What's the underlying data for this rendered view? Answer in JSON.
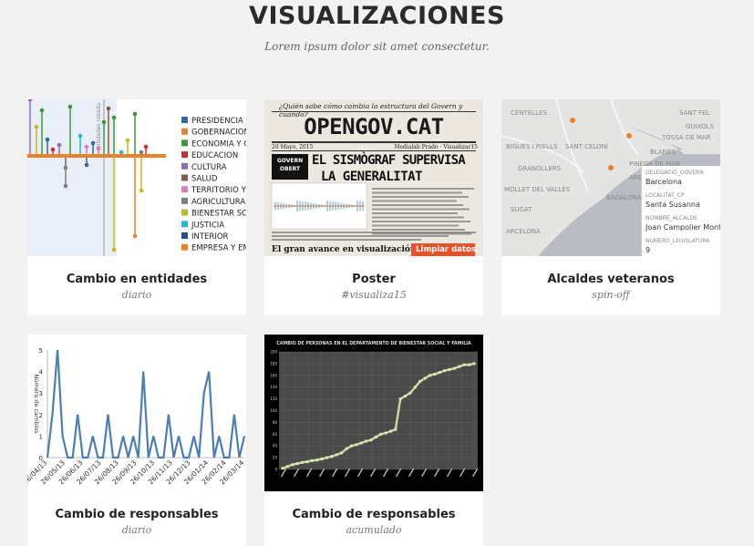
{
  "header": {
    "title": "VISUALIZACIONES",
    "subtitle": "Lorem ipsum dolor sit amet consectetur."
  },
  "cards": [
    {
      "title": "Cambio en entidades",
      "subtitle": "diario",
      "thumb": {
        "axis_label": "entidades creada",
        "legend": [
          {
            "label": "PRESIDENCIA",
            "color": "#2e6da4"
          },
          {
            "label": "GOBERNACION",
            "color": "#e8832a"
          },
          {
            "label": "ECONOMIA Y C",
            "color": "#3a9a3a"
          },
          {
            "label": "EDUCACION",
            "color": "#c9302c"
          },
          {
            "label": "CULTURA",
            "color": "#8e6bbf"
          },
          {
            "label": "SALUD",
            "color": "#8c564b"
          },
          {
            "label": "TERRITORIO Y S",
            "color": "#e377c2"
          },
          {
            "label": "AGRICULTURA",
            "color": "#7f7f7f"
          },
          {
            "label": "BIENESTAR SOC",
            "color": "#bcbd22"
          },
          {
            "label": "JUSTICIA",
            "color": "#17becf"
          },
          {
            "label": "INTERIOR",
            "color": "#1f4e8c"
          },
          {
            "label": "EMPRESA Y EM",
            "color": "#ff7f0e"
          }
        ]
      }
    },
    {
      "title": "Poster",
      "subtitle": "#visualiza15",
      "thumb": {
        "top_question": "¿Quién sabe cómo cambia la estructura del Govern y cuándo?",
        "masthead": "OPENGOV.CAT",
        "date": "20 Mayo, 2015",
        "byline": "Medialab Prado · Visualizar15",
        "badge_line1": "GOVERN",
        "badge_line2": "OBERT",
        "headline1": "EL SISMÒGRAF SUPERVISA",
        "headline2": "LA GENERALITAT",
        "bottom_headline": "El gran avance en visualización y",
        "bottom_box": "Limpiar datos,"
      }
    },
    {
      "title": "Alcaldes veteranos",
      "subtitle": "spin-off",
      "thumb": {
        "places": [
          "CENTELLES",
          "SANT FEL",
          "GUIXOLS",
          "BIGUES I RIELLS",
          "SANT CELONI",
          "TOSSA DE MAR",
          "BLANES",
          "PINEDA DE MAR",
          "GRANOLLERS",
          "ARENYS DE MAR",
          "MOLLET DEL VALLÈS",
          "SUGAT",
          "BADALONA",
          "ARCELONA"
        ],
        "popup": [
          {
            "key": "DELEGACIO_GOVERN",
            "value": "Barcelona"
          },
          {
            "key": "LOCALITAT_CP",
            "value": "Santa Susanna"
          },
          {
            "key": "NOMBRE_ALCALDE",
            "value": "Joan Campolier Monts"
          },
          {
            "key": "NUMERO_LEGISLATURA",
            "value": "9"
          }
        ]
      }
    },
    {
      "title": "Cambio de responsables",
      "subtitle": "diario",
      "chart_data": {
        "type": "line",
        "ylabel": "Número de cambios",
        "ylim": [
          0,
          5
        ],
        "yticks": [
          "0",
          "1",
          "2",
          "3",
          "4",
          "5"
        ],
        "xticks": [
          "26/04/13",
          "26/05/13",
          "26/06/13",
          "26/07/13",
          "26/08/13",
          "26/09/13",
          "26/10/13",
          "26/11/13",
          "26/12/13",
          "26/01/14",
          "26/02/14",
          "26/03/14"
        ],
        "series": [
          {
            "values": [
              0,
              2,
              5,
              1,
              0,
              0,
              2,
              0,
              0,
              1,
              0,
              0,
              2,
              0,
              0,
              1,
              0,
              1,
              0,
              4,
              0,
              1,
              0,
              0,
              2,
              0,
              1,
              0,
              0,
              1,
              0,
              3,
              4,
              0,
              1,
              0,
              0,
              2,
              0,
              1
            ]
          }
        ]
      }
    },
    {
      "title": "Cambio de responsables",
      "subtitle": "acumulado",
      "chart_data": {
        "type": "line",
        "title": "CAMBIO DE PERSONAS EN EL DEPARTAMENTO DE BIENESTAR SOCIAL Y FAMILIA",
        "ylim": [
          0,
          200
        ],
        "yticks": [
          "0",
          "20",
          "40",
          "60",
          "80",
          "100",
          "120",
          "140",
          "160",
          "180",
          "200"
        ],
        "series": [
          {
            "values": [
              2,
              5,
              8,
              10,
              12,
              13,
              15,
              16,
              18,
              20,
              22,
              25,
              28,
              35,
              40,
              42,
              45,
              48,
              50,
              55,
              60,
              62,
              65,
              68,
              120,
              125,
              130,
              140,
              150,
              155,
              160,
              162,
              165,
              168,
              170,
              172,
              175,
              178,
              178,
              180
            ]
          }
        ]
      }
    }
  ]
}
